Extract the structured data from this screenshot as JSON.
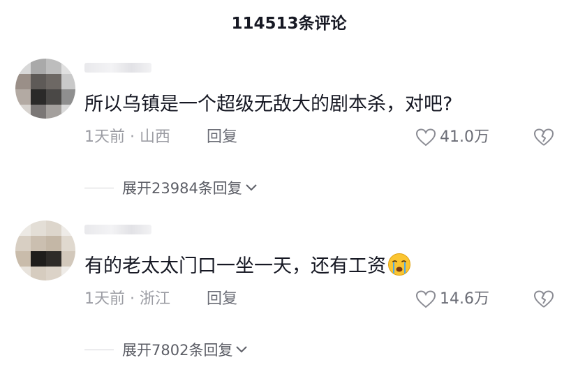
{
  "header": {
    "title": "114513条评论"
  },
  "comments": [
    {
      "text": "所以乌镇是一个超级无敌大的剧本杀，对吧?",
      "meta": "1天前 · 山西",
      "reply_label": "回复",
      "likes": "41.0万",
      "expand_label": "展开23984条回复"
    },
    {
      "text": "有的老太太门口一坐一天，还有工资",
      "emoji": "crying-face-icon",
      "meta": "1天前 · 浙江",
      "reply_label": "回复",
      "likes": "14.6万",
      "expand_label": "展开7802条回复"
    }
  ],
  "colors": {
    "text_primary": "#161823",
    "text_secondary": "#9b9ca3",
    "action_gray": "#6b6d76"
  }
}
